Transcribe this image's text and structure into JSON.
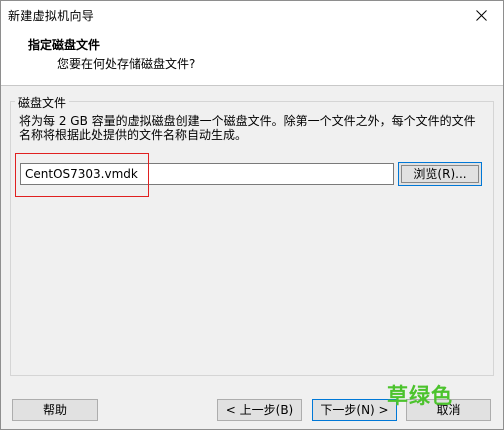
{
  "window": {
    "title": "新建虚拟机向导"
  },
  "header": {
    "title": "指定磁盘文件",
    "subtitle": "您要在何处存储磁盘文件?"
  },
  "disk_file_group": {
    "legend": "磁盘文件",
    "description": "将为每 2 GB 容量的虚拟磁盘创建一个磁盘文件。除第一个文件之外，每个文件的文件名称将根据此处提供的文件名称自动生成。",
    "file_name_value": "CentOS7303.vmdk",
    "browse_label": "浏览(R)..."
  },
  "buttons": {
    "help_label": "帮助",
    "prev_label": "< 上一步(B)",
    "next_label": "下一步(N) >",
    "cancel_label": "取消"
  },
  "watermark": {
    "text": "草绿色"
  },
  "icons": {
    "close": "close-icon"
  }
}
